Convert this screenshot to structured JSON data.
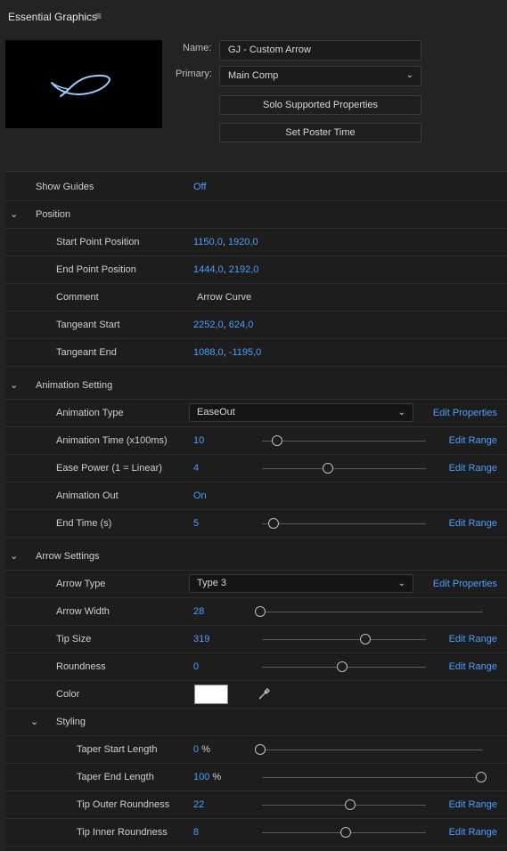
{
  "header": {
    "title": "Essential Graphics",
    "menu_icon": "hamburger-icon"
  },
  "form": {
    "name_label": "Name:",
    "name_value": "GJ - Custom Arrow",
    "primary_label": "Primary:",
    "primary_value": "Main Comp",
    "solo_button": "Solo Supported Properties",
    "poster_button": "Set Poster Time"
  },
  "rows": {
    "show_guides": {
      "label": "Show Guides",
      "value": "Off"
    },
    "position": {
      "label": "Position"
    },
    "start_point": {
      "label": "Start Point Position",
      "x": "1150,0",
      "y": "1920,0"
    },
    "end_point": {
      "label": "End Point Position",
      "x": "1444,0",
      "y": "2192,0"
    },
    "comment": {
      "label": "Comment",
      "value": "Arrow Curve"
    },
    "tangeant_start": {
      "label": "Tangeant Start",
      "x": "2252,0",
      "y": "624,0"
    },
    "tangeant_end": {
      "label": "Tangeant End",
      "x": "1088,0",
      "y": "-1195,0"
    },
    "animation_setting": {
      "label": "Animation Setting"
    },
    "animation_type": {
      "label": "Animation Type",
      "value": "EaseOut",
      "edit": "Edit Properties"
    },
    "animation_time": {
      "label": "Animation Time (x100ms)",
      "value": "10",
      "edit": "Edit Range",
      "level": 0.09
    },
    "ease_power": {
      "label": "Ease Power (1 = Linear)",
      "value": "4",
      "edit": "Edit Range",
      "level": 0.4
    },
    "animation_out": {
      "label": "Animation Out",
      "value": "On"
    },
    "end_time": {
      "label": "End Time (s)",
      "value": "5",
      "edit": "Edit Range",
      "level": 0.07
    },
    "arrow_settings": {
      "label": "Arrow Settings"
    },
    "arrow_type": {
      "label": "Arrow Type",
      "value": "Type 3",
      "edit": "Edit Properties"
    },
    "arrow_width": {
      "label": "Arrow  Width",
      "value": "28",
      "level": 0.0
    },
    "tip_size": {
      "label": "Tip Size",
      "value": "319",
      "edit": "Edit Range",
      "level": 0.63
    },
    "roundness": {
      "label": "Roundness",
      "value": "0",
      "edit": "Edit Range",
      "level": 0.49
    },
    "color": {
      "label": "Color",
      "swatch": "#ffffff"
    },
    "styling": {
      "label": "Styling"
    },
    "taper_start": {
      "label": "Taper Start Length",
      "value": "0",
      "unit": "%",
      "level": 0.0
    },
    "taper_end": {
      "label": "Taper End Length",
      "value": "100",
      "unit": "%",
      "level": 1.0
    },
    "tip_outer": {
      "label": "Tip Outer Roundness",
      "value": "22",
      "edit": "Edit Range",
      "level": 0.54
    },
    "tip_inner": {
      "label": "Tip Inner Roundness",
      "value": "8",
      "edit": "Edit Range",
      "level": 0.51
    }
  },
  "colors": {
    "accent": "#4a9fff",
    "thumbnail_stroke": "#9ecbff"
  }
}
